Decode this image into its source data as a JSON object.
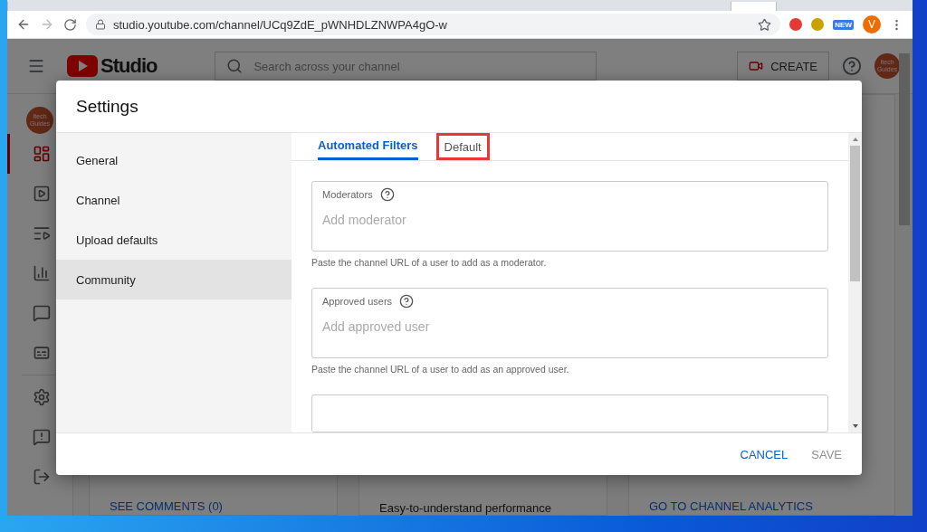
{
  "browser": {
    "url": "studio.youtube.com/channel/UCq9ZdE_pWNHDLZNWPA4gO-w",
    "badge": "NEW",
    "profile_initial": "V"
  },
  "studio": {
    "logo_text": "Studio",
    "search": {
      "placeholder": "Search across your channel"
    },
    "create_label": "CREATE",
    "header_avatar": [
      "Itech",
      "Guides"
    ],
    "sidebar_avatar": [
      "Itech",
      "Guides"
    ],
    "sidebar": [
      {
        "selected": true
      },
      {
        "selected": false
      },
      {
        "selected": false
      },
      {
        "selected": false
      },
      {
        "selected": false
      },
      {
        "selected": false
      },
      {
        "selected": false
      },
      {
        "selected": false
      },
      {
        "selected": false
      }
    ],
    "cards": [
      {
        "links": [
          "SEE COMMENTS (0)"
        ]
      },
      {
        "text": "Easy-to-understand performance"
      },
      {
        "links": [
          "GO TO CHANNEL ANALYTICS"
        ]
      }
    ]
  },
  "dialog": {
    "title": "Settings",
    "nav": [
      {
        "label": "General",
        "selected": false
      },
      {
        "label": "Channel",
        "selected": false
      },
      {
        "label": "Upload defaults",
        "selected": false
      },
      {
        "label": "Community",
        "selected": true
      }
    ],
    "tabs": [
      {
        "label": "Automated Filters",
        "selected": true,
        "highlighted": false
      },
      {
        "label": "Default",
        "selected": false,
        "highlighted": true
      }
    ],
    "fields": [
      {
        "label": "Moderators",
        "placeholder": "Add moderator",
        "hint": "Paste the channel URL of a user to add as a moderator."
      },
      {
        "label": "Approved users",
        "placeholder": "Add approved user",
        "hint": "Paste the channel URL of a user to add as an approved user."
      }
    ],
    "buttons": [
      {
        "label": "CANCEL",
        "disabled": false
      },
      {
        "label": "SAVE",
        "disabled": true
      }
    ]
  }
}
